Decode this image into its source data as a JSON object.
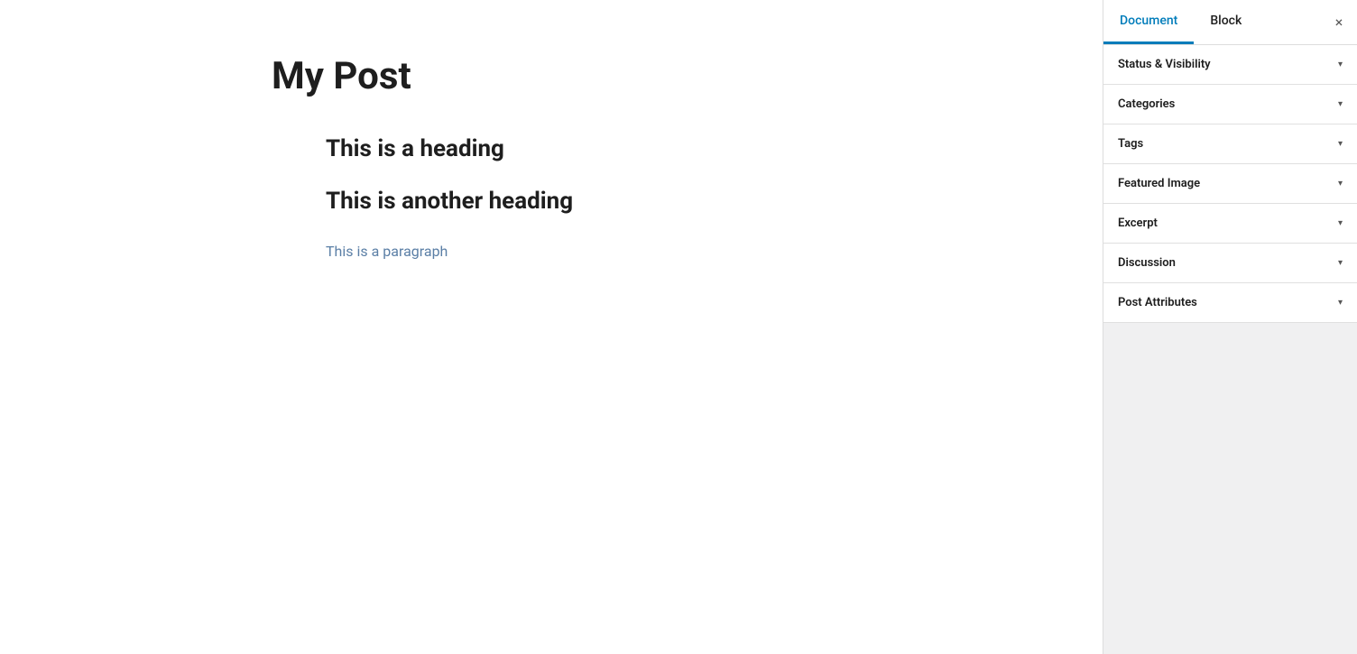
{
  "editor": {
    "post_title": "My Post",
    "blocks": [
      {
        "type": "heading",
        "content": "This is a heading"
      },
      {
        "type": "heading",
        "content": "This is another heading"
      },
      {
        "type": "paragraph",
        "content": "This is a paragraph"
      }
    ]
  },
  "sidebar": {
    "tab_document_label": "Document",
    "tab_block_label": "Block",
    "close_label": "×",
    "panels": [
      {
        "label": "Status & Visibility"
      },
      {
        "label": "Categories"
      },
      {
        "label": "Tags"
      },
      {
        "label": "Featured Image"
      },
      {
        "label": "Excerpt"
      },
      {
        "label": "Discussion"
      },
      {
        "label": "Post Attributes"
      }
    ],
    "chevron": "▾"
  }
}
